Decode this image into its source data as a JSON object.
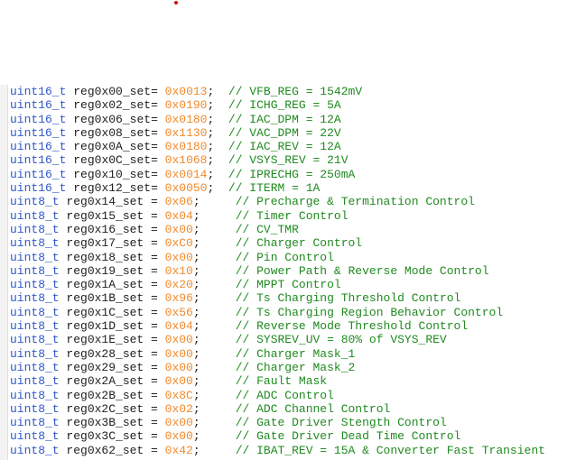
{
  "lines": [
    {
      "type": "uint16_t",
      "name": "reg0x00_set",
      "eq": "= ",
      "value": "0x0013",
      "sep": ";  ",
      "comment": "// VFB_REG = 1542mV"
    },
    {
      "type": "uint16_t",
      "name": "reg0x02_set",
      "eq": "= ",
      "value": "0x0190",
      "sep": ";  ",
      "comment": "// ICHG_REG = 5A"
    },
    {
      "type": "uint16_t",
      "name": "reg0x06_set",
      "eq": "= ",
      "value": "0x0180",
      "sep": ";  ",
      "comment": "// IAC_DPM = 12A"
    },
    {
      "type": "uint16_t",
      "name": "reg0x08_set",
      "eq": "= ",
      "value": "0x1130",
      "sep": ";  ",
      "comment": "// VAC_DPM = 22V"
    },
    {
      "type": "uint16_t",
      "name": "reg0x0A_set",
      "eq": "= ",
      "value": "0x0180",
      "sep": ";  ",
      "comment": "// IAC_REV = 12A"
    },
    {
      "type": "uint16_t",
      "name": "reg0x0C_set",
      "eq": "= ",
      "value": "0x1068",
      "sep": ";  ",
      "comment": "// VSYS_REV = 21V"
    },
    {
      "type": "uint16_t",
      "name": "reg0x10_set",
      "eq": "= ",
      "value": "0x0014",
      "sep": ";  ",
      "comment": "// IPRECHG = 250mA"
    },
    {
      "type": "uint16_t",
      "name": "reg0x12_set",
      "eq": "= ",
      "value": "0x0050",
      "sep": ";  ",
      "comment": "// ITERM = 1A"
    },
    {
      "type": "uint8_t",
      "name": "reg0x14_set",
      "eq": " = ",
      "value": "0x06",
      "sep": ";     ",
      "comment": "// Precharge & Termination Control"
    },
    {
      "type": "uint8_t",
      "name": "reg0x15_set",
      "eq": " = ",
      "value": "0x04",
      "sep": ";     ",
      "comment": "// Timer Control"
    },
    {
      "type": "uint8_t",
      "name": "reg0x16_set",
      "eq": " = ",
      "value": "0x00",
      "sep": ";     ",
      "comment": "// CV_TMR"
    },
    {
      "type": "uint8_t",
      "name": "reg0x17_set",
      "eq": " = ",
      "value": "0xC0",
      "sep": ";     ",
      "comment": "// Charger Control"
    },
    {
      "type": "uint8_t",
      "name": "reg0x18_set",
      "eq": " = ",
      "value": "0x00",
      "sep": ";     ",
      "comment": "// Pin Control"
    },
    {
      "type": "uint8_t",
      "name": "reg0x19_set",
      "eq": " = ",
      "value": "0x10",
      "sep": ";     ",
      "comment": "// Power Path & Reverse Mode Control"
    },
    {
      "type": "uint8_t",
      "name": "reg0x1A_set",
      "eq": " = ",
      "value": "0x20",
      "sep": ";     ",
      "comment": "// MPPT Control"
    },
    {
      "type": "uint8_t",
      "name": "reg0x1B_set",
      "eq": " = ",
      "value": "0x96",
      "sep": ";     ",
      "comment": "// Ts Charging Threshold Control"
    },
    {
      "type": "uint8_t",
      "name": "reg0x1C_set",
      "eq": " = ",
      "value": "0x56",
      "sep": ";     ",
      "comment": "// Ts Charging Region Behavior Control"
    },
    {
      "type": "uint8_t",
      "name": "reg0x1D_set",
      "eq": " = ",
      "value": "0x04",
      "sep": ";     ",
      "comment": "// Reverse Mode Threshold Control"
    },
    {
      "type": "uint8_t",
      "name": "reg0x1E_set",
      "eq": " = ",
      "value": "0x00",
      "sep": ";     ",
      "comment": "// SYSREV_UV = 80% of VSYS_REV"
    },
    {
      "type": "uint8_t",
      "name": "reg0x28_set",
      "eq": " = ",
      "value": "0x00",
      "sep": ";     ",
      "comment": "// Charger Mask_1"
    },
    {
      "type": "uint8_t",
      "name": "reg0x29_set",
      "eq": " = ",
      "value": "0x00",
      "sep": ";     ",
      "comment": "// Charger Mask_2"
    },
    {
      "type": "uint8_t",
      "name": "reg0x2A_set",
      "eq": " = ",
      "value": "0x00",
      "sep": ";     ",
      "comment": "// Fault Mask"
    },
    {
      "type": "uint8_t",
      "name": "reg0x2B_set",
      "eq": " = ",
      "value": "0x8C",
      "sep": ";     ",
      "comment": "// ADC Control"
    },
    {
      "type": "uint8_t",
      "name": "reg0x2C_set",
      "eq": " = ",
      "value": "0x02",
      "sep": ";     ",
      "comment": "// ADC Channel Control"
    },
    {
      "type": "uint8_t",
      "name": "reg0x3B_set",
      "eq": " = ",
      "value": "0x00",
      "sep": ";     ",
      "comment": "// Gate Driver Stength Control"
    },
    {
      "type": "uint8_t",
      "name": "reg0x3C_set",
      "eq": " = ",
      "value": "0x00",
      "sep": ";     ",
      "comment": "// Gate Driver Dead Time Control"
    },
    {
      "type": "uint8_t",
      "name": "reg0x62_set",
      "eq": " = ",
      "value": "0x42",
      "sep": ";     ",
      "comment": "// IBAT_REV = 15A & Converter Fast Transient"
    }
  ],
  "colors": {
    "type": "#2f57c9",
    "hex": "#f08a2c",
    "comment": "#1f8a1f",
    "text": "#202020",
    "marker": "#d01010"
  }
}
